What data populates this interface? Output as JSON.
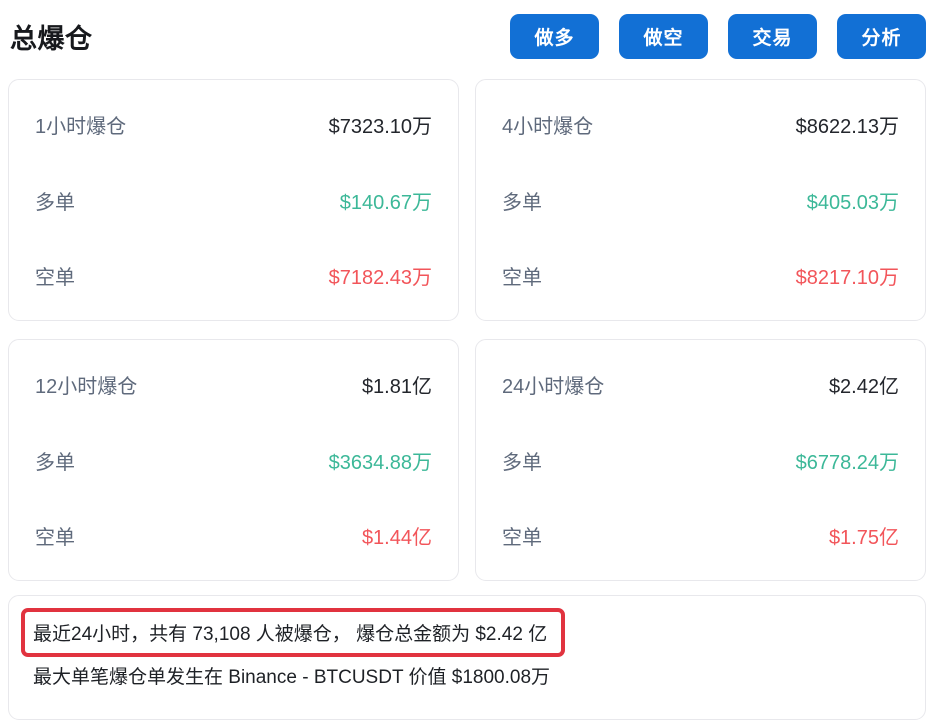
{
  "page": {
    "title": "总爆仓"
  },
  "header": {
    "buttons": [
      {
        "label": "做多"
      },
      {
        "label": "做空"
      },
      {
        "label": "交易"
      },
      {
        "label": "分析"
      }
    ]
  },
  "cards": [
    {
      "period_label": "1小时爆仓",
      "total": "$7323.10万",
      "long_label": "多单",
      "long_value": "$140.67万",
      "short_label": "空单",
      "short_value": "$7182.43万"
    },
    {
      "period_label": "4小时爆仓",
      "total": "$8622.13万",
      "long_label": "多单",
      "long_value": "$405.03万",
      "short_label": "空单",
      "short_value": "$8217.10万"
    },
    {
      "period_label": "12小时爆仓",
      "total": "$1.81亿",
      "long_label": "多单",
      "long_value": "$3634.88万",
      "short_label": "空单",
      "short_value": "$1.44亿"
    },
    {
      "period_label": "24小时爆仓",
      "total": "$2.42亿",
      "long_label": "多单",
      "long_value": "$6778.24万",
      "short_label": "空单",
      "short_value": "$1.75亿"
    }
  ],
  "summary": {
    "highlighted_line": "最近24小时，共有 73,108 人被爆仓， 爆仓总金额为 $2.42 亿",
    "secondary_line": "最大单笔爆仓单发生在 Binance - BTCUSDT 价值 $1800.08万"
  },
  "colors": {
    "accent_blue": "#1270d5",
    "long_green": "#3cb898",
    "short_red": "#f2555a",
    "highlight_border_red": "#e1333f"
  }
}
